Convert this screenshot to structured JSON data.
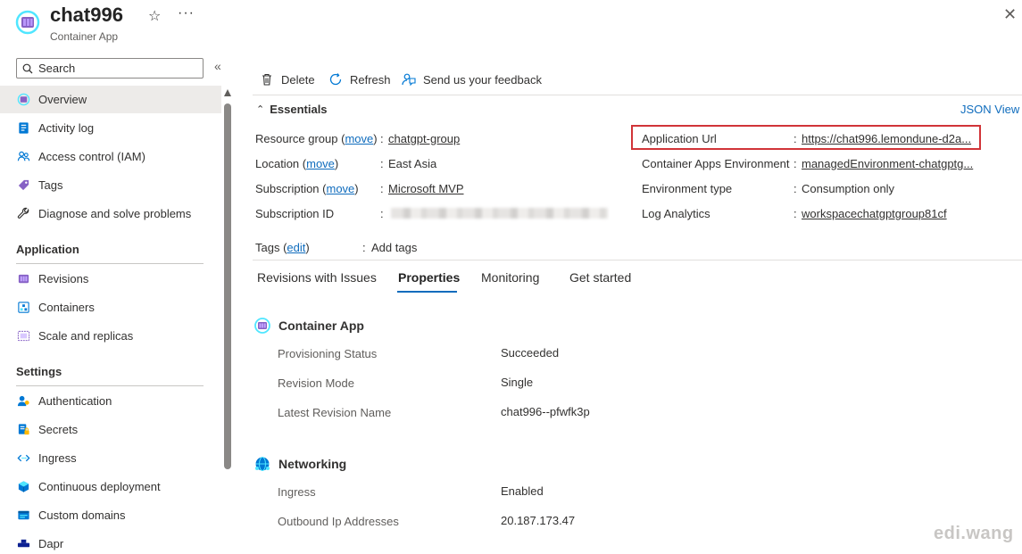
{
  "header": {
    "title": "chat996",
    "subtitle": "Container App"
  },
  "sidebar": {
    "search_placeholder": "Search",
    "items": [
      {
        "label": "Overview",
        "icon": "container-app-icon",
        "active": true
      },
      {
        "label": "Activity log",
        "icon": "activity-log-icon"
      },
      {
        "label": "Access control (IAM)",
        "icon": "people-icon"
      },
      {
        "label": "Tags",
        "icon": "tag-icon"
      },
      {
        "label": "Diagnose and solve problems",
        "icon": "wrench-icon"
      }
    ],
    "sections": [
      {
        "title": "Application",
        "items": [
          {
            "label": "Revisions",
            "icon": "revisions-icon"
          },
          {
            "label": "Containers",
            "icon": "containers-icon"
          },
          {
            "label": "Scale and replicas",
            "icon": "scale-icon"
          }
        ]
      },
      {
        "title": "Settings",
        "items": [
          {
            "label": "Authentication",
            "icon": "authentication-icon"
          },
          {
            "label": "Secrets",
            "icon": "secrets-icon"
          },
          {
            "label": "Ingress",
            "icon": "ingress-icon"
          },
          {
            "label": "Continuous deployment",
            "icon": "cube-icon"
          },
          {
            "label": "Custom domains",
            "icon": "domain-icon"
          },
          {
            "label": "Dapr",
            "icon": "dapr-icon"
          }
        ]
      }
    ]
  },
  "toolbar": {
    "delete_label": "Delete",
    "refresh_label": "Refresh",
    "feedback_label": "Send us your feedback"
  },
  "essentials": {
    "title": "Essentials",
    "json_view": "JSON View",
    "left": [
      {
        "label": "Resource group",
        "move": "move",
        "value": "chatgpt-group",
        "link": true
      },
      {
        "label": "Location",
        "move": "move",
        "value": "East Asia",
        "link": false
      },
      {
        "label": "Subscription",
        "move": "move",
        "value": "Microsoft MVP",
        "link": true
      },
      {
        "label": "Subscription ID",
        "move": "",
        "value": "",
        "link": false
      }
    ],
    "right": [
      {
        "label": "Application Url",
        "value": "https://chat996.lemondune-d2a...",
        "link": true
      },
      {
        "label": "Container Apps Environment",
        "value": "managedEnvironment-chatgptg...",
        "link": true
      },
      {
        "label": "Environment type",
        "value": "Consumption only",
        "link": false
      },
      {
        "label": "Log Analytics",
        "value": "workspacechatgptgroup81cf",
        "link": true
      }
    ],
    "tags_label": "Tags",
    "tags_edit": "edit",
    "tags_value": "Add tags",
    "colon": ":",
    "open_paren": " (",
    "close_paren": ")"
  },
  "tabs": [
    "Revisions with Issues",
    "Properties",
    "Monitoring",
    "Get started"
  ],
  "properties": {
    "container_app": {
      "title": "Container App",
      "rows": [
        {
          "label": "Provisioning Status",
          "value": "Succeeded"
        },
        {
          "label": "Revision Mode",
          "value": "Single"
        },
        {
          "label": "Latest Revision Name",
          "value": "chat996--pfwfk3p"
        }
      ]
    },
    "networking": {
      "title": "Networking",
      "rows": [
        {
          "label": "Ingress",
          "value": "Enabled",
          "link": true
        },
        {
          "label": "Outbound Ip Addresses",
          "value": "20.187.173.47"
        }
      ]
    }
  },
  "watermark": "edi.wang",
  "colors": {
    "accent": "#0f6cbd",
    "highlight": "#d13438"
  }
}
